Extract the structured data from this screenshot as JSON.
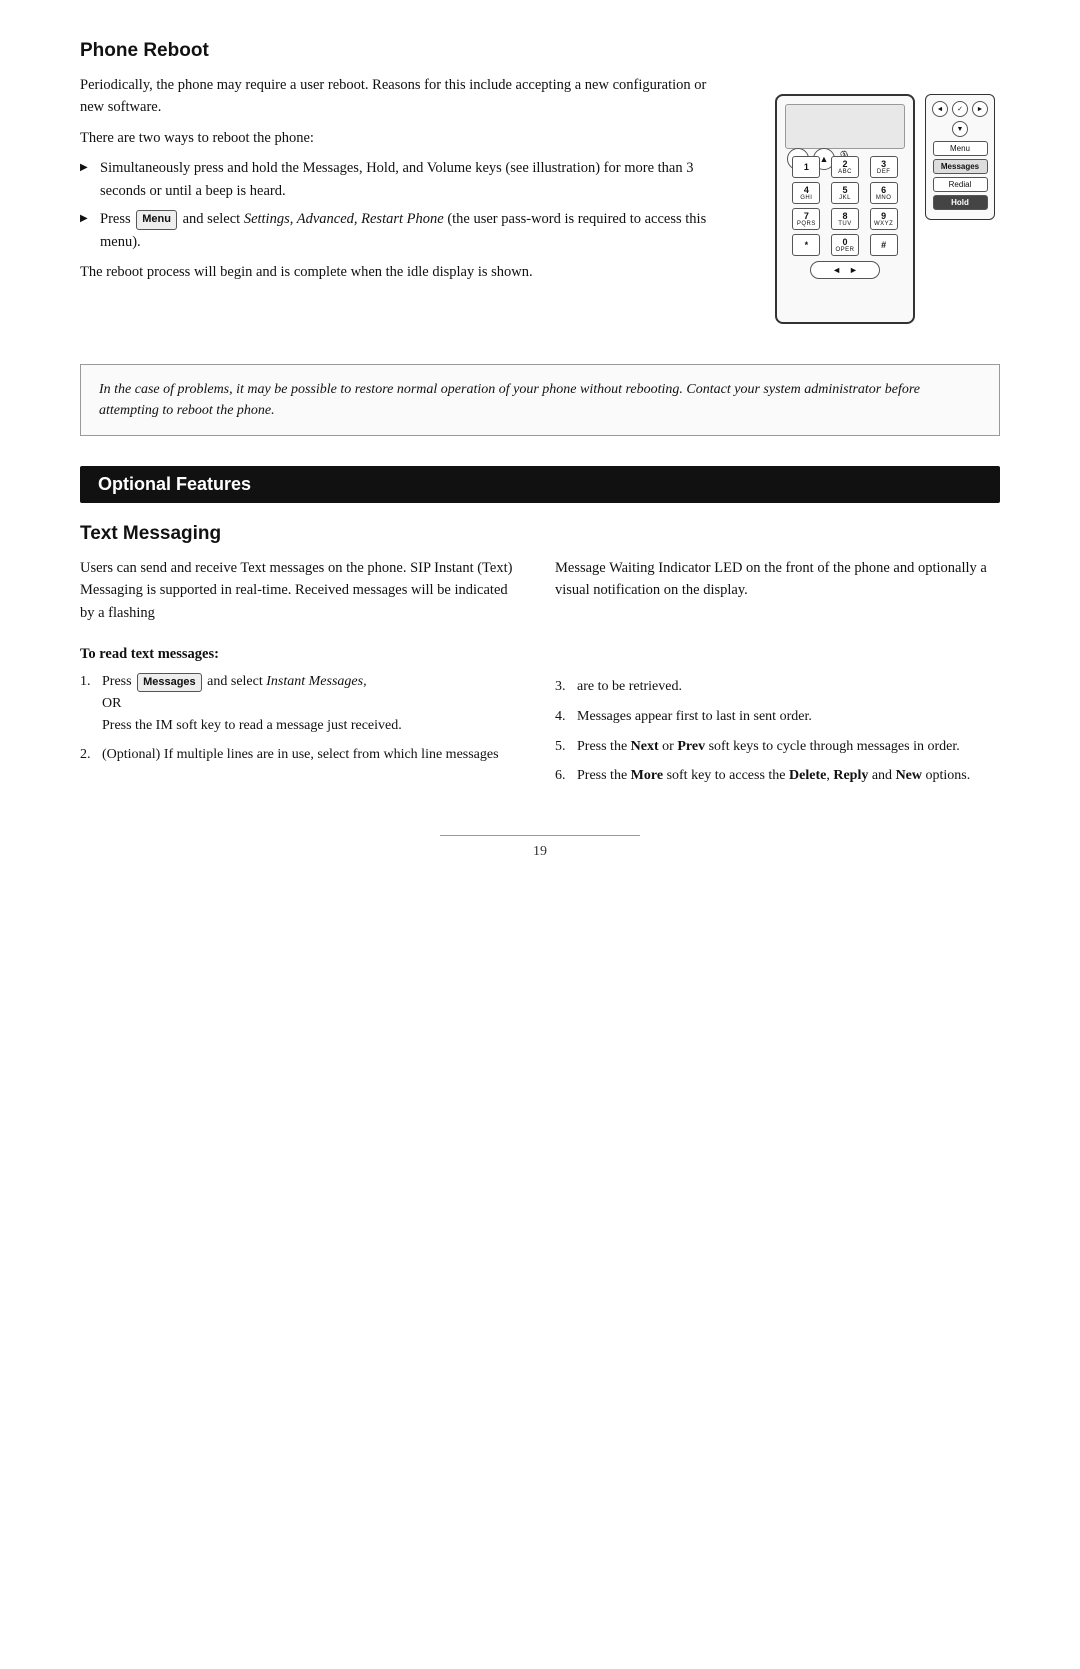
{
  "phone_reboot": {
    "title": "Phone Reboot",
    "intro1": "Periodically, the phone may require a user reboot.  Reasons for this include accepting a new configuration or new software.",
    "intro2": "There are two ways to reboot the phone:",
    "bullet1": "Simultaneously press and hold the Messages, Hold, and Volume keys (see illustration) for more than 3 seconds or until a beep is heard.",
    "bullet2_prefix": "Press",
    "menu_btn": "Menu",
    "bullet2_suffix": "and select Settings, Advanced, Restart Phone (the user pass-word is required to access this menu).",
    "bullet2_italic": "Settings, Advanced, Restart Phone",
    "outro": "The reboot process will begin and is complete when the idle display is shown.",
    "note": "In the case of problems, it may be possible to restore normal operation of your phone without rebooting.  Contact your system administrator before attempting to reboot the phone."
  },
  "optional_features": {
    "banner": "Optional Features"
  },
  "text_messaging": {
    "title": "Text Messaging",
    "col_left_text": "Users can send and receive Text messages on the phone.  SIP Instant (Text) Messaging is supported in real-time.  Received messages will be indicated by a flashing",
    "col_right_text": "Message Waiting Indicator LED on the front of the phone and optionally a visual notification on the display.",
    "to_read_heading": "To read text messages:",
    "step1_prefix": "Press",
    "messages_btn": "Messages",
    "step1_suffix": "and select",
    "step1_italic": "Instant Messages,",
    "step1_or": "OR",
    "step1_im": "Press the IM soft key to read a message just received.",
    "step2": "(Optional)  If multiple lines are in use, select from which line messages",
    "step3_right": "are to be retrieved.",
    "step4_right": "Messages appear first to last in sent order.",
    "step5_right_prefix": "Press the",
    "step5_next": "Next",
    "step5_or": "or",
    "step5_prev": "Prev",
    "step5_suffix": "soft keys to cycle through messages in order.",
    "step6_prefix": "Press the",
    "step6_more": "More",
    "step6_suffix": "soft key to access the",
    "step6_bold": "Delete, Reply",
    "step6_and": "and",
    "step6_new": "New",
    "step6_end": "options."
  },
  "footer": {
    "page_number": "19"
  },
  "phone_keys": {
    "row1": [
      "1",
      "2\nABC",
      "3\nDEF"
    ],
    "row2": [
      "4\nGHI",
      "5\nJKL",
      "6\nMNO"
    ],
    "row3": [
      "7\nPQRS",
      "8\nTUV",
      "9\nWXYZ"
    ],
    "row4": [
      "*",
      "0\nOPER",
      "#"
    ],
    "side_buttons": [
      "Menu",
      "Messages",
      "Redial",
      "Hold"
    ]
  }
}
